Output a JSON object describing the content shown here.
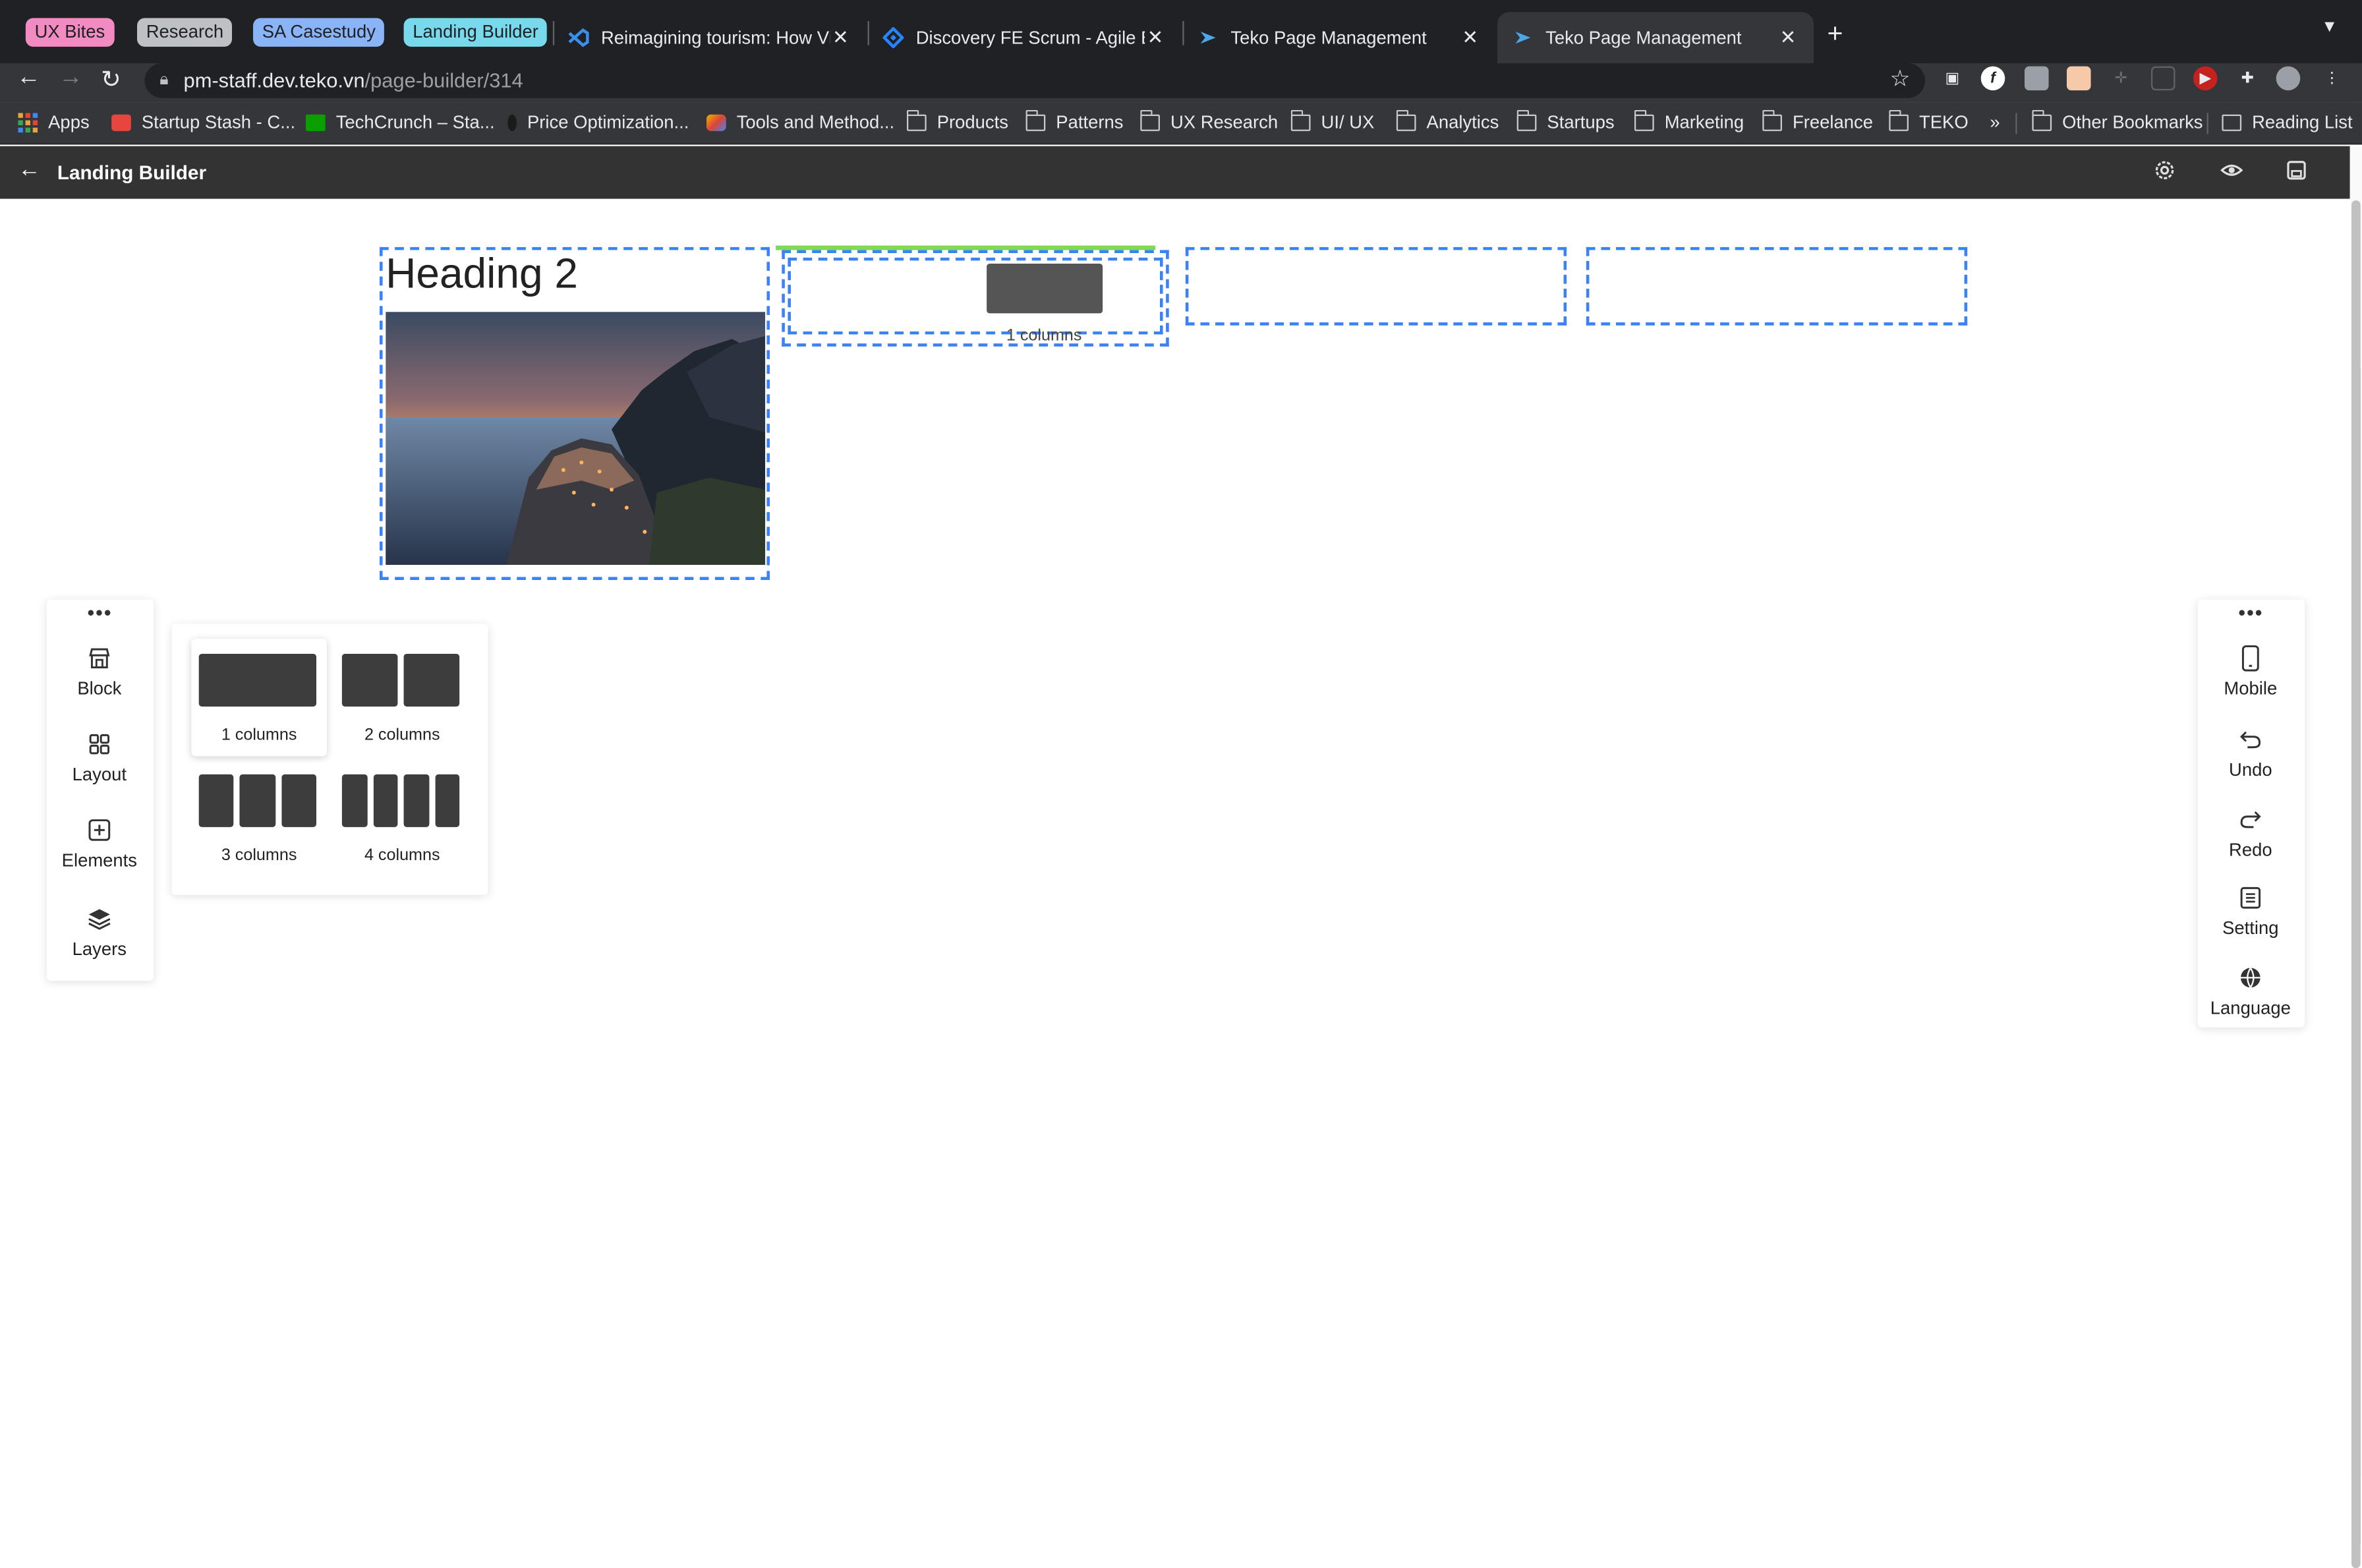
{
  "tab_groups": [
    {
      "label": "UX Bites",
      "color": "#f28bc1"
    },
    {
      "label": "Research",
      "color": "#bdc1c6"
    },
    {
      "label": "SA Casestudy",
      "color": "#8ab4f8"
    },
    {
      "label": "Landing Builder",
      "color": "#78d9ec"
    }
  ],
  "tabs": [
    {
      "title": "Reimagining tourism: How Viet",
      "icon": "vscode-icon",
      "close": "✕",
      "active": false
    },
    {
      "title": "Discovery FE Scrum - Agile Bo",
      "icon": "jira-icon",
      "close": "✕",
      "active": false
    },
    {
      "title": "Teko Page Management",
      "icon": "teko-icon",
      "close": "✕",
      "active": false
    },
    {
      "title": "Teko Page Management",
      "icon": "teko-icon",
      "close": "✕",
      "active": true
    }
  ],
  "browser": {
    "url_host": "pm-staff.dev.teko.vn",
    "url_path": "/page-builder/314",
    "new_tab": "+",
    "tab_menu": "▼",
    "back": "←",
    "forward": "→",
    "reload": "↻"
  },
  "bookmarks": {
    "items": [
      {
        "label": "Apps",
        "icon": "apps-grid-icon"
      },
      {
        "label": "Startup Stash - C...",
        "icon": "startup-stash-icon"
      },
      {
        "label": "TechCrunch – Sta...",
        "icon": "techcrunch-icon"
      },
      {
        "label": "Price Optimization...",
        "icon": "price-icon"
      },
      {
        "label": "Tools and Method...",
        "icon": "tools-icon"
      },
      {
        "label": "Products",
        "icon": "folder-icon"
      },
      {
        "label": "Patterns",
        "icon": "folder-icon"
      },
      {
        "label": "UX Research",
        "icon": "folder-icon"
      },
      {
        "label": "UI/ UX",
        "icon": "folder-icon"
      },
      {
        "label": "Analytics",
        "icon": "folder-icon"
      },
      {
        "label": "Startups",
        "icon": "folder-icon"
      },
      {
        "label": "Marketing",
        "icon": "folder-icon"
      },
      {
        "label": "Freelance",
        "icon": "folder-icon"
      },
      {
        "label": "TEKO",
        "icon": "folder-icon"
      }
    ],
    "overflow": "»",
    "other": "Other Bookmarks",
    "reading_list": "Reading List"
  },
  "app": {
    "back": "←",
    "title": "Landing Builder",
    "actions": [
      "settings-icon",
      "preview-eye-icon",
      "save-icon"
    ]
  },
  "canvas": {
    "heading": "Heading 2",
    "drag_label": "1 columns"
  },
  "left_sidebar": {
    "more": "•••",
    "items": [
      {
        "label": "Block",
        "icon": "store-icon"
      },
      {
        "label": "Layout",
        "icon": "grid-icon"
      },
      {
        "label": "Elements",
        "icon": "plus-square-icon"
      },
      {
        "label": "Layers",
        "icon": "layers-icon"
      }
    ]
  },
  "layout_popup": {
    "options": [
      {
        "label": "1 columns",
        "columns": 1,
        "selected": true
      },
      {
        "label": "2 columns",
        "columns": 2,
        "selected": false
      },
      {
        "label": "3 columns",
        "columns": 3,
        "selected": false
      },
      {
        "label": "4 columns",
        "columns": 4,
        "selected": false
      }
    ]
  },
  "right_sidebar": {
    "more": "•••",
    "items": [
      {
        "label": "Mobile",
        "icon": "mobile-icon"
      },
      {
        "label": "Undo",
        "icon": "undo-icon"
      },
      {
        "label": "Redo",
        "icon": "redo-icon"
      },
      {
        "label": "Setting",
        "icon": "setting-list-icon"
      },
      {
        "label": "Language",
        "icon": "globe-icon"
      }
    ]
  }
}
